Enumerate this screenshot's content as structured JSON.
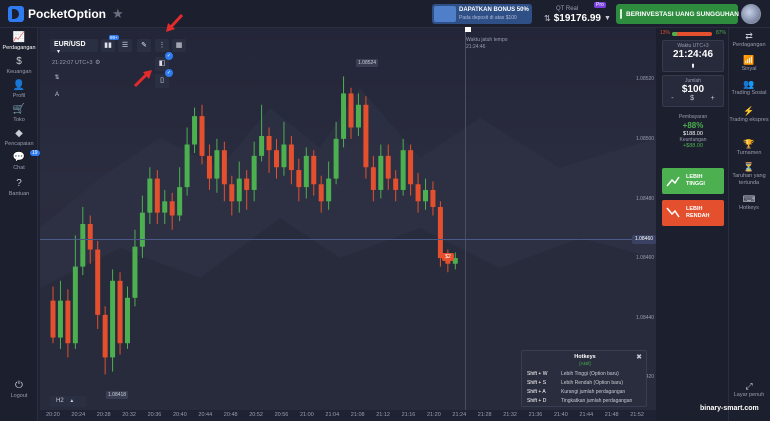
{
  "app": {
    "logo_text": "PocketOption"
  },
  "promo": {
    "title": "DAPATKAN BONUS 50%",
    "subtitle": "Pada deposit di atas $100"
  },
  "account": {
    "label": "QT Real",
    "balance": "$19176.99",
    "badge": "Pro"
  },
  "deposit_button": "BERINVESTASI UANG SUNGGUHAN",
  "left_nav": [
    {
      "icon": "chart-line-icon",
      "glyph": "📈",
      "label": "Perdagangan"
    },
    {
      "icon": "dollar-icon",
      "glyph": "$",
      "label": "Keuangan"
    },
    {
      "icon": "user-icon",
      "glyph": "👤",
      "label": "Profil"
    },
    {
      "icon": "cart-icon",
      "glyph": "🛒",
      "label": "Toko"
    },
    {
      "icon": "diamond-icon",
      "glyph": "◆",
      "label": "Pencapaian"
    },
    {
      "icon": "chat-icon",
      "glyph": "💬",
      "label": "Chat"
    },
    {
      "icon": "help-icon",
      "glyph": "?",
      "label": "Bantuan"
    },
    {
      "icon": "logout-icon",
      "glyph": "⏻",
      "label": "Logout"
    }
  ],
  "chat_badge": "19",
  "toolbar": {
    "asset": "EUR/USD",
    "indicator_badge": "99+"
  },
  "chart_clock": "21:22:07 UTC+3",
  "expiry": {
    "label": "Waktu jatuh tempo",
    "time": "21:24:46"
  },
  "price_labels": [
    "1.08520",
    "1.08500",
    "1.08480",
    "1.08460",
    "1.08440",
    "1.08420"
  ],
  "current_price": "1.08460",
  "high_label": "1.08524",
  "low_label": "1.08418",
  "trade_tag": "$2",
  "timeframe": "H2",
  "time_labels": [
    "20:20",
    "20:24",
    "20:28",
    "20:32",
    "20:36",
    "20:40",
    "20:44",
    "20:48",
    "20:52",
    "20:56",
    "21:00",
    "21:04",
    "21:08",
    "21:12",
    "21:16",
    "21:20",
    "21:24",
    "21:28",
    "21:32",
    "21:36",
    "21:40",
    "21:44",
    "21:48",
    "21:52"
  ],
  "sentiment": {
    "left": "13%",
    "right": "87%",
    "up_fraction": 0.13
  },
  "panel": {
    "time_caption": "Waktu UTC+3",
    "time_value": "21:24:46",
    "amount_caption": "Jumlah",
    "amount_value": "$100",
    "minus": "-",
    "currency": "$",
    "plus": "+",
    "payout_caption": "Pembayaran",
    "payout_pct": "+88%",
    "payout_amount": "$188.00",
    "profit_caption": "Keuntungan",
    "profit_amount": "+$88.00",
    "higher_label_1": "LEBIH",
    "higher_label_2": "TINGGI",
    "lower_label_1": "LEBIH",
    "lower_label_2": "RENDAH"
  },
  "right_nav": [
    {
      "icon": "trading-icon",
      "glyph": "⇄",
      "label": "Perdagangan"
    },
    {
      "icon": "signal-icon",
      "glyph": "📶",
      "label": "Sinyal"
    },
    {
      "icon": "social-trading-icon",
      "glyph": "👥",
      "label": "Trading Sosial"
    },
    {
      "icon": "express-icon",
      "glyph": "⚡",
      "label": "Trading ekspres"
    },
    {
      "icon": "tournament-icon",
      "glyph": "🏆",
      "label": "Turnamen"
    },
    {
      "icon": "pending-icon",
      "glyph": "⏳",
      "label": "Taruhan yang tertunda"
    },
    {
      "icon": "hotkeys-icon",
      "glyph": "⌨",
      "label": "Hotkeys"
    },
    {
      "icon": "fullscreen-icon",
      "glyph": "⤢",
      "label": "Layar penuh"
    }
  ],
  "hotkeys": {
    "title": "Hotkeys",
    "subtitle": "[Aktif]",
    "rows": [
      {
        "key": "Shift + W",
        "desc": "Lebih Tinggi (Option baru)"
      },
      {
        "key": "Shift + S",
        "desc": "Lebih Rendah (Option baru)"
      },
      {
        "key": "Shift + A",
        "desc": "Kurangi jumlah perdagangan"
      },
      {
        "key": "Shift + D",
        "desc": "Tingkatkan jumlah perdagangan"
      }
    ]
  },
  "watermark": "binary-smart.com",
  "colors": {
    "up": "#4caf50",
    "down": "#e4502e",
    "accent": "#2f7bf2",
    "bg": "#1f2233"
  },
  "candles": [
    [
      1.08445,
      1.08432,
      1.0845,
      1.0843,
      "d"
    ],
    [
      1.08432,
      1.08445,
      1.08452,
      1.08428,
      "u"
    ],
    [
      1.08445,
      1.0843,
      1.08449,
      1.08425,
      "d"
    ],
    [
      1.0843,
      1.08457,
      1.08468,
      1.08428,
      "u"
    ],
    [
      1.08457,
      1.08472,
      1.08478,
      1.08454,
      "u"
    ],
    [
      1.08472,
      1.08463,
      1.08475,
      1.08458,
      "d"
    ],
    [
      1.08463,
      1.0844,
      1.08466,
      1.08435,
      "d"
    ],
    [
      1.0844,
      1.08425,
      1.08443,
      1.08419,
      "d"
    ],
    [
      1.08425,
      1.08452,
      1.08456,
      1.0842,
      "u"
    ],
    [
      1.08452,
      1.0843,
      1.08455,
      1.08426,
      "d"
    ],
    [
      1.0843,
      1.08446,
      1.0845,
      1.08428,
      "u"
    ],
    [
      1.08446,
      1.08464,
      1.0847,
      1.08443,
      "u"
    ],
    [
      1.08464,
      1.08476,
      1.08482,
      1.0846,
      "u"
    ],
    [
      1.08476,
      1.08488,
      1.08492,
      1.08472,
      "u"
    ],
    [
      1.08488,
      1.08476,
      1.08491,
      1.08472,
      "d"
    ],
    [
      1.08476,
      1.0848,
      1.08484,
      1.08472,
      "u"
    ],
    [
      1.0848,
      1.08475,
      1.08483,
      1.0847,
      "d"
    ],
    [
      1.08475,
      1.08485,
      1.08492,
      1.08473,
      "u"
    ],
    [
      1.08485,
      1.085,
      1.08506,
      1.08482,
      "u"
    ],
    [
      1.085,
      1.0851,
      1.08513,
      1.08497,
      "u"
    ],
    [
      1.0851,
      1.08496,
      1.08514,
      1.08493,
      "d"
    ],
    [
      1.08496,
      1.08488,
      1.085,
      1.08484,
      "d"
    ],
    [
      1.08488,
      1.08498,
      1.08502,
      1.08483,
      "u"
    ],
    [
      1.08498,
      1.08486,
      1.08501,
      1.0848,
      "d"
    ],
    [
      1.08486,
      1.0848,
      1.08489,
      1.08475,
      "d"
    ],
    [
      1.0848,
      1.08488,
      1.08494,
      1.08476,
      "u"
    ],
    [
      1.08488,
      1.08484,
      1.08491,
      1.08477,
      "d"
    ],
    [
      1.08484,
      1.08496,
      1.08501,
      1.0848,
      "u"
    ],
    [
      1.08496,
      1.08503,
      1.08514,
      1.08494,
      "u"
    ],
    [
      1.08503,
      1.08498,
      1.08506,
      1.0849,
      "d"
    ],
    [
      1.08498,
      1.08492,
      1.08502,
      1.08488,
      "d"
    ],
    [
      1.08492,
      1.085,
      1.08508,
      1.08489,
      "u"
    ],
    [
      1.085,
      1.08491,
      1.08503,
      1.08486,
      "d"
    ],
    [
      1.08491,
      1.08485,
      1.08495,
      1.0848,
      "d"
    ],
    [
      1.08485,
      1.08496,
      1.08499,
      1.08481,
      "u"
    ],
    [
      1.08496,
      1.08486,
      1.08498,
      1.08482,
      "d"
    ],
    [
      1.08486,
      1.0848,
      1.08489,
      1.08476,
      "d"
    ],
    [
      1.0848,
      1.08488,
      1.08494,
      1.08477,
      "u"
    ],
    [
      1.08488,
      1.08502,
      1.08508,
      1.08486,
      "u"
    ],
    [
      1.08502,
      1.08518,
      1.08524,
      1.08499,
      "u"
    ],
    [
      1.08518,
      1.08506,
      1.0852,
      1.08502,
      "d"
    ],
    [
      1.08506,
      1.08514,
      1.08518,
      1.08503,
      "u"
    ],
    [
      1.08514,
      1.08492,
      1.08517,
      1.08488,
      "d"
    ],
    [
      1.08492,
      1.08484,
      1.08496,
      1.0848,
      "d"
    ],
    [
      1.08484,
      1.08496,
      1.085,
      1.08481,
      "u"
    ],
    [
      1.08496,
      1.08488,
      1.085,
      1.08484,
      "d"
    ],
    [
      1.08488,
      1.08484,
      1.08491,
      1.0848,
      "d"
    ],
    [
      1.08484,
      1.08498,
      1.08502,
      1.08482,
      "u"
    ],
    [
      1.08498,
      1.08486,
      1.085,
      1.08482,
      "d"
    ],
    [
      1.08486,
      1.0848,
      1.0849,
      1.08476,
      "d"
    ],
    [
      1.0848,
      1.08484,
      1.08488,
      1.08477,
      "u"
    ],
    [
      1.08484,
      1.08478,
      1.08487,
      1.08475,
      "d"
    ],
    [
      1.08478,
      1.0846,
      1.0848,
      1.08457,
      "d"
    ],
    [
      1.0846,
      1.08458,
      1.08463,
      1.08455,
      "d"
    ],
    [
      1.08458,
      1.0846,
      1.08462,
      1.08456,
      "u"
    ]
  ]
}
